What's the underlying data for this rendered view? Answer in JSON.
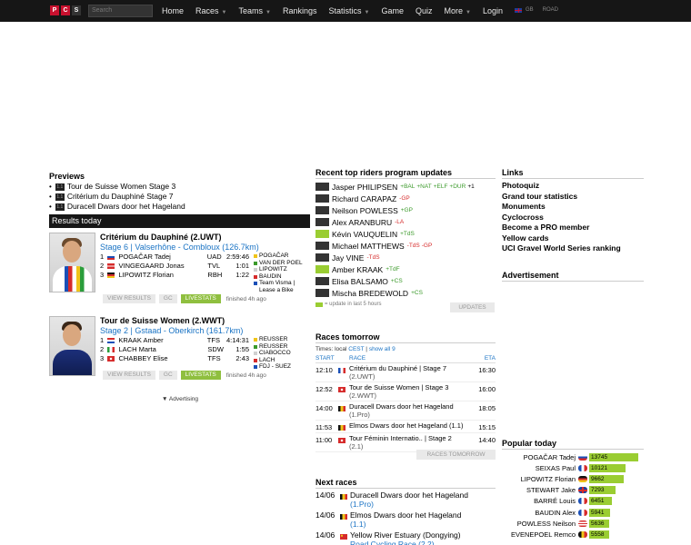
{
  "nav": {
    "logo": [
      "P",
      "C",
      "S"
    ],
    "search_placeholder": "Search",
    "items": [
      {
        "label": "Home",
        "caret": false
      },
      {
        "label": "Races",
        "caret": true
      },
      {
        "label": "Teams",
        "caret": true
      },
      {
        "label": "Rankings",
        "caret": false
      },
      {
        "label": "Statistics",
        "caret": true
      },
      {
        "label": "Game",
        "caret": false
      },
      {
        "label": "Quiz",
        "caret": false
      },
      {
        "label": "More",
        "caret": true
      },
      {
        "label": "Login",
        "caret": false
      }
    ],
    "lang": "GB",
    "mode": "ROAD"
  },
  "previews": {
    "title": "Previews",
    "items": [
      "Tour de Suisse Women Stage 3",
      "Critérium du Dauphiné Stage 7",
      "Duracell Dwars door het Hageland"
    ]
  },
  "results_today": {
    "title": "Results today",
    "races": [
      {
        "title": "Critérium du Dauphiné (2.UWT)",
        "stage": "Stage 6 | Valserhône - Combloux (126.7km)",
        "results": [
          {
            "pos": "1",
            "flag": "si",
            "name": "POGAČAR Tadej",
            "team": "UAD",
            "time": "2:59:46"
          },
          {
            "pos": "2",
            "flag": "dk",
            "name": "VINGEGAARD Jonas",
            "team": "TVL",
            "time": "1:01"
          },
          {
            "pos": "3",
            "flag": "de",
            "name": "LIPOWITZ Florian",
            "team": "RBH",
            "time": "1:22"
          }
        ],
        "jerseys": [
          {
            "color": "#f0c419",
            "label": "POGAČAR"
          },
          {
            "color": "#3b9a2a",
            "label": "VAN DER POEL"
          },
          {
            "color": "#d0d0d0",
            "label": "LIPOWITZ"
          },
          {
            "color": "#d62b2b",
            "label": "BAUDIN"
          },
          {
            "color": "#1a4fb7",
            "label": "Team Visma | Lease a Bike"
          }
        ],
        "buttons": [
          "VIEW RESULTS",
          "GC",
          "LIVESTATS"
        ],
        "finished": "finished 4h ago"
      },
      {
        "title": "Tour de Suisse Women (2.WWT)",
        "stage": "Stage 2 | Gstaad - Oberkirch (161.7km)",
        "results": [
          {
            "pos": "1",
            "flag": "nl",
            "name": "KRAAK Amber",
            "team": "TFS",
            "time": "4:14:31"
          },
          {
            "pos": "2",
            "flag": "it",
            "name": "LACH Marta",
            "team": "SDW",
            "time": "1:55"
          },
          {
            "pos": "3",
            "flag": "ch",
            "name": "CHABBEY Elise",
            "team": "TFS",
            "time": "2:43"
          }
        ],
        "jerseys": [
          {
            "color": "#f0c419",
            "label": "REUSSER"
          },
          {
            "color": "#3b9a2a",
            "label": "REUSSER"
          },
          {
            "color": "#d0d0d0",
            "label": "CIABOCCO"
          },
          {
            "color": "#d62b2b",
            "label": "LACH"
          },
          {
            "color": "#1a4fb7",
            "label": "FDJ - SUEZ"
          }
        ],
        "buttons": [
          "VIEW RESULTS",
          "GC",
          "LIVESTATS"
        ],
        "finished": "finished 4h ago"
      }
    ],
    "advertising": "▼ Advertising"
  },
  "recent_updates": {
    "title": "Recent top riders program updates",
    "rows": [
      {
        "box": "dark",
        "name": "Jasper PHILIPSEN",
        "tags": [
          {
            "t": "+BAL",
            "c": "green"
          },
          {
            "t": "+NAT",
            "c": "green"
          },
          {
            "t": "+ELF",
            "c": "green"
          },
          {
            "t": "+DUR",
            "c": "green"
          },
          {
            "t": "+1",
            "c": "black"
          }
        ]
      },
      {
        "box": "dark",
        "name": "Richard CARAPAZ",
        "tags": [
          {
            "t": "-GP",
            "c": "red"
          }
        ]
      },
      {
        "box": "dark",
        "name": "Neilson POWLESS",
        "tags": [
          {
            "t": "+GP",
            "c": "green"
          }
        ]
      },
      {
        "box": "dark",
        "name": "Alex ARANBURU",
        "tags": [
          {
            "t": "-LA",
            "c": "red"
          }
        ]
      },
      {
        "box": "green",
        "name": "Kévin VAUQUELIN",
        "tags": [
          {
            "t": "+TdS",
            "c": "green"
          }
        ]
      },
      {
        "box": "dark",
        "name": "Michael MATTHEWS",
        "tags": [
          {
            "t": "-TdS",
            "c": "red"
          },
          {
            "t": "-GP",
            "c": "red"
          }
        ]
      },
      {
        "box": "dark",
        "name": "Jay VINE",
        "tags": [
          {
            "t": "-TdS",
            "c": "red"
          }
        ]
      },
      {
        "box": "green",
        "name": "Amber KRAAK",
        "tags": [
          {
            "t": "+TdF",
            "c": "green"
          }
        ]
      },
      {
        "box": "dark",
        "name": "Elisa BALSAMO",
        "tags": [
          {
            "t": "+CS",
            "c": "green"
          }
        ]
      },
      {
        "box": "dark",
        "name": "Mischa BREDEWOLD",
        "tags": [
          {
            "t": "+CS",
            "c": "green"
          }
        ]
      }
    ],
    "footnote": "= update in last 5 hours",
    "button": "UPDATES"
  },
  "races_tomorrow": {
    "title": "Races tomorrow",
    "times_label": "Times:",
    "local": "local",
    "cest": "CEST",
    "show_all": "show all 9",
    "headers": [
      "START",
      "RACE",
      "ETA"
    ],
    "rows": [
      {
        "start": "12:10",
        "race": "Critérium du Dauphiné | Stage 7",
        "sub": "(2.UWT)",
        "eta": "16:30",
        "flag": "fr"
      },
      {
        "start": "12:52",
        "race": "Tour de Suisse Women | Stage 3",
        "sub": "(2.WWT)",
        "eta": "16:00",
        "flag": "ch"
      },
      {
        "start": "14:00",
        "race": "Duracell Dwars door het Hageland",
        "sub": "(1.Pro)",
        "eta": "18:05",
        "flag": "be"
      },
      {
        "start": "11:53",
        "race": "Elmos Dwars door het Hageland (1.1)",
        "sub": "",
        "eta": "15:15",
        "flag": "be"
      },
      {
        "start": "11:00",
        "race": "Tour Féminin Internatio.. | Stage 2",
        "sub": "(2.1)",
        "eta": "14:40",
        "flag": "ch"
      }
    ],
    "button": "RACES TOMORROW"
  },
  "next_races": {
    "title": "Next races",
    "rows": [
      {
        "date": "14/06",
        "name": "Duracell Dwars door het Hageland",
        "sub": "(1.Pro)",
        "flag": "be"
      },
      {
        "date": "14/06",
        "name": "Elmos Dwars door het Hageland",
        "sub": "(1.1)",
        "flag": "be"
      },
      {
        "date": "14/06",
        "name": "Yellow River Estuary (Dongying)",
        "sub": "Road Cycling Race (2.2)",
        "flag": "cn"
      }
    ]
  },
  "links": {
    "title": "Links",
    "items": [
      "Photoquiz",
      "Grand tour statistics",
      "Monuments",
      "Cyclocross",
      "Become a PRO member",
      "Yellow cards",
      "UCI Gravel World Series ranking"
    ],
    "advertisement": "Advertisement"
  },
  "popular": {
    "title": "Popular today",
    "rows": [
      {
        "name": "POGAČAR Tadej",
        "flag": "si",
        "value": 13745
      },
      {
        "name": "SEIXAS Paul",
        "flag": "fr",
        "value": 10121
      },
      {
        "name": "LIPOWITZ Florian",
        "flag": "de",
        "value": 9662
      },
      {
        "name": "STEWART Jake",
        "flag": "gb",
        "value": 7293
      },
      {
        "name": "BARRÉ Louis",
        "flag": "fr",
        "value": 6451
      },
      {
        "name": "BAUDIN Alex",
        "flag": "fr",
        "value": 5941
      },
      {
        "name": "POWLESS Neilson",
        "flag": "us",
        "value": 5636
      },
      {
        "name": "EVENEPOEL Remco",
        "flag": "be",
        "value": 5558
      }
    ],
    "max": 13745
  },
  "colors": {
    "accent": "#1a73c4",
    "bar": "#9acd32",
    "navbar": "#161616"
  }
}
